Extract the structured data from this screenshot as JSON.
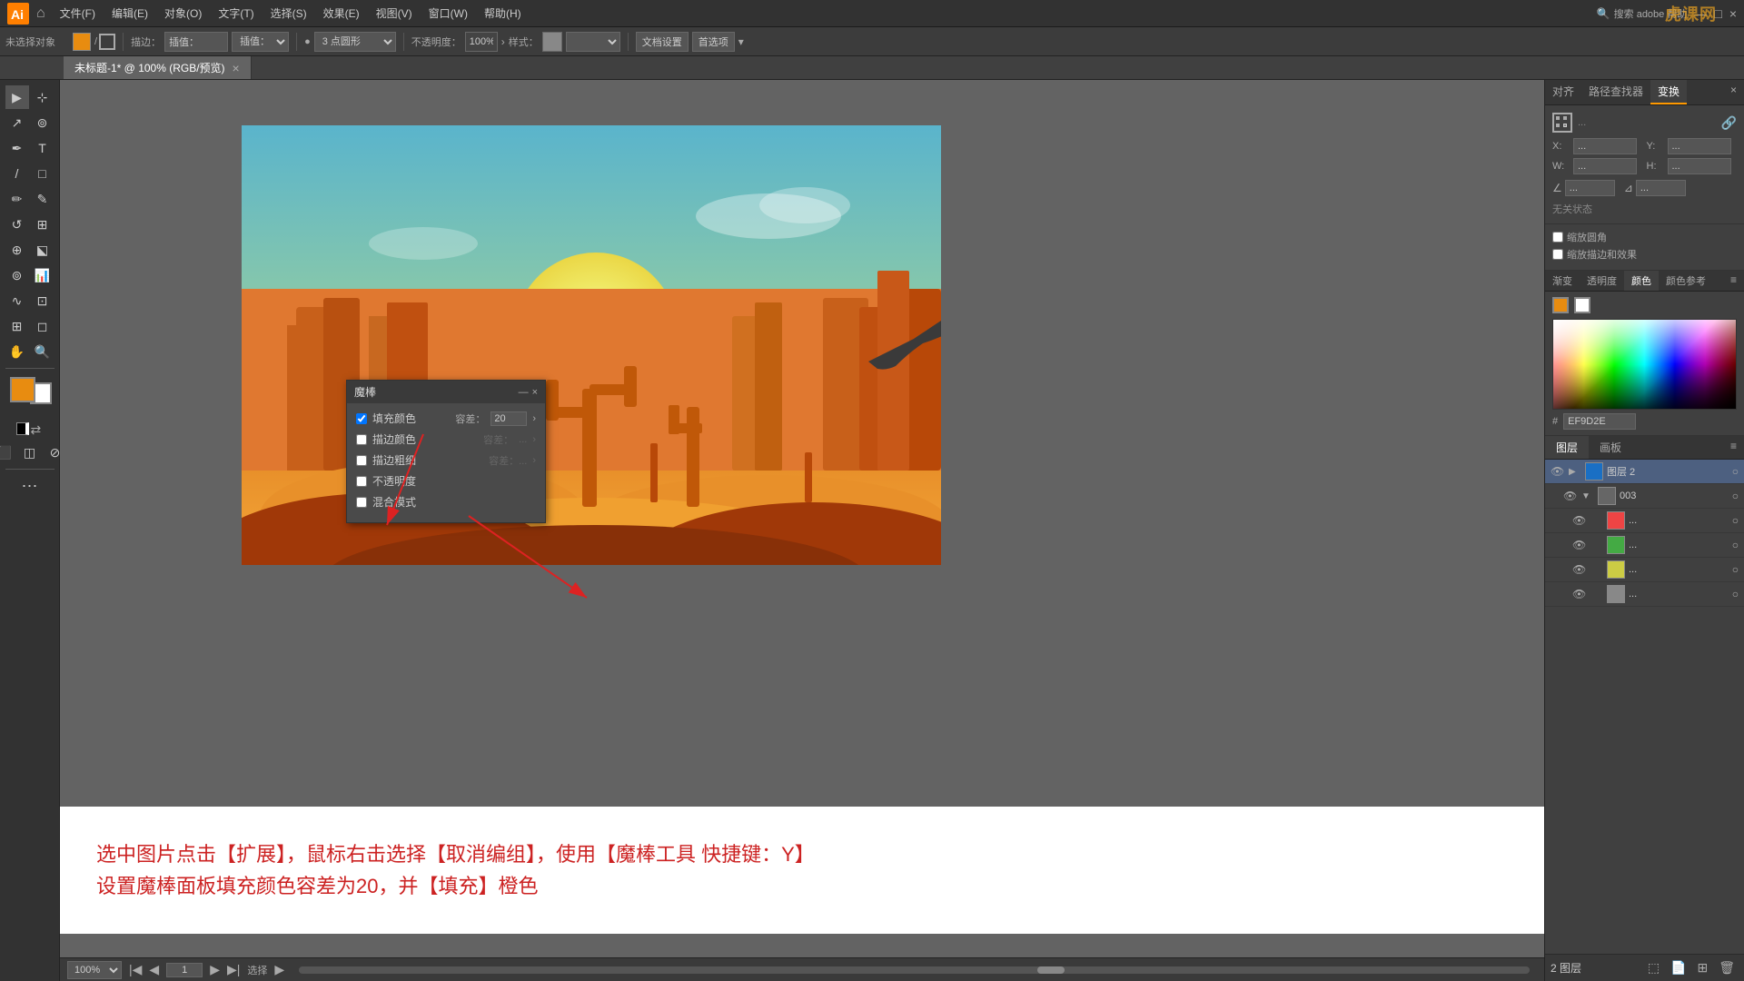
{
  "app": {
    "title": "Adobe Illustrator",
    "watermark": "虎课网"
  },
  "menu_bar": {
    "items": [
      "文件(F)",
      "编辑(E)",
      "对象(O)",
      "文字(T)",
      "选择(S)",
      "效果(E)",
      "视图(V)",
      "窗口(W)",
      "帮助(H)"
    ]
  },
  "toolbar": {
    "no_selection": "未选择对象",
    "brush_label": "描边：",
    "pan_label": "插值：",
    "point_label": "3 点圆形",
    "opacity_label": "不透明度：",
    "opacity_value": "100%",
    "style_label": "样式：",
    "doc_settings": "文档设置",
    "preferences": "首选项"
  },
  "tab": {
    "title": "未标题-1* @ 100% (RGB/预览)",
    "close": "×"
  },
  "magic_wand_panel": {
    "title": "魔棒",
    "fill_color_label": "填充颜色",
    "fill_color_checked": true,
    "fill_tolerance_label": "容差：",
    "fill_tolerance_value": "20",
    "stroke_color_label": "描边颜色",
    "stroke_color_checked": false,
    "stroke_tolerance_label": "容差：",
    "stroke_tolerance_value": "...",
    "stroke_width_label": "描边粗细",
    "stroke_width_checked": false,
    "stroke_width_tolerance": "...",
    "opacity_label": "不透明度",
    "opacity_checked": false,
    "blend_label": "混合模式",
    "blend_checked": false
  },
  "transform_panel": {
    "tab_align": "对齐",
    "tab_pathfinder": "路径查找器",
    "tab_transform": "变换",
    "x_label": "X",
    "y_label": "Y",
    "w_label": "W",
    "h_label": "H",
    "no_select": "无关状态"
  },
  "color_panel": {
    "tab_gradient": "渐变",
    "tab_transparency": "透明度",
    "tab_color": "颜色",
    "tab_color_ref": "颜色参考",
    "hex_label": "#",
    "hex_value": "EF9D2E"
  },
  "layers_panel": {
    "tab_layers": "图层",
    "tab_artboard": "画板",
    "layer2_name": "图层 2",
    "item_003": "003",
    "items": [
      {
        "name": "图层 2",
        "color": "#1a6fc4",
        "expanded": true
      },
      {
        "name": "003",
        "color": "#888",
        "expanded": true
      },
      {
        "name": "...",
        "dot_color": "#e44"
      },
      {
        "name": "...",
        "dot_color": "#4a4"
      },
      {
        "name": "...",
        "dot_color": "#cc4"
      },
      {
        "name": "...",
        "dot_color": "#888"
      }
    ],
    "footer_label": "2 图层"
  },
  "status_bar": {
    "zoom": "100%",
    "page": "1",
    "mode": "选择"
  },
  "instruction": {
    "line1": "选中图片点击【扩展】，鼠标右击选择【取消编组】，使用【魔棒工具 快捷键：Y】",
    "line2": "设置魔棒面板填充颜色容差为20，并【填充】橙色"
  },
  "arrows": {
    "color": "#dd2222"
  },
  "tools": [
    "▶",
    "⊹",
    "↗",
    "✏",
    "✒",
    "T",
    "/",
    "□",
    "○",
    "↺",
    "⊕",
    "⬕",
    "📊",
    "∿",
    "⊡",
    "🔍",
    "↔",
    "✋",
    "🔍"
  ],
  "colors": {
    "bg_dark": "#323232",
    "bg_medium": "#404040",
    "bg_light": "#636363",
    "accent_orange": "#e88c10",
    "accent_blue": "#1a6fc4",
    "text_light": "#ccc",
    "canvas_bg": "#636363"
  }
}
